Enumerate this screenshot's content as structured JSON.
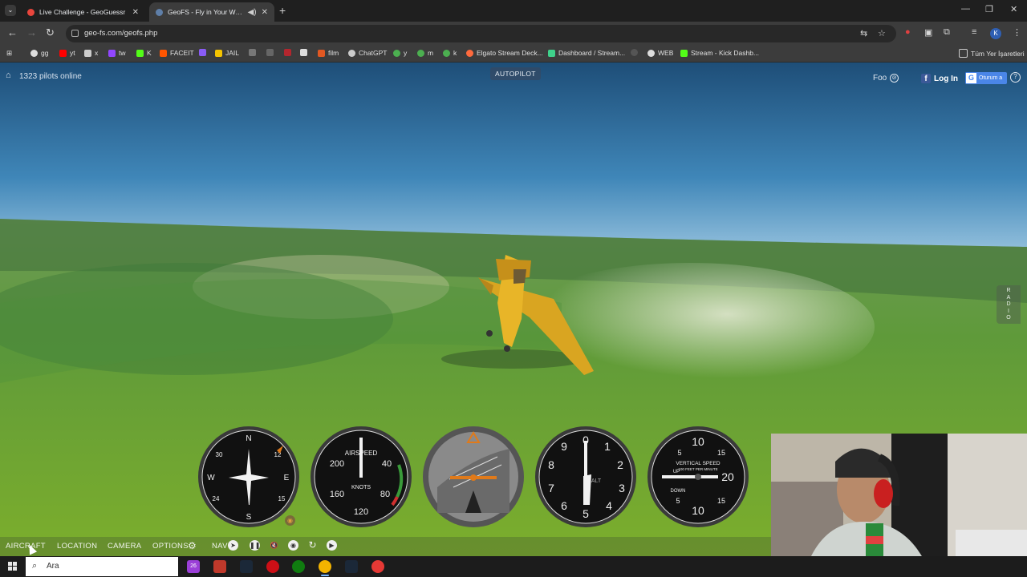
{
  "browser": {
    "tabs": [
      {
        "title": "Live Challenge - GeoGuessr",
        "favicon_color": "#e8453c",
        "active": false
      },
      {
        "title": "GeoFS - Fly in Your Web Br...",
        "favicon_color": "#5f7fa8",
        "active": true
      }
    ],
    "url": "geo-fs.com/geofs.php",
    "profile_initial": "K",
    "bookmarks": [
      {
        "label": "gg",
        "color": "#dddddd"
      },
      {
        "label": "yt",
        "color": "#ff0000"
      },
      {
        "label": "x",
        "color": "#cccccc"
      },
      {
        "label": "tw",
        "color": "#9146ff"
      },
      {
        "label": "K",
        "color": "#53fc18"
      },
      {
        "label": "FACEIT",
        "color": "#ff5500"
      },
      {
        "label": "",
        "color": "#8a5cf5"
      },
      {
        "label": "JAIL",
        "color": "#f5c400"
      },
      {
        "label": "",
        "color": "#777777"
      },
      {
        "label": "",
        "color": "#666666"
      },
      {
        "label": "",
        "color": "#b3262e"
      },
      {
        "label": "",
        "color": "#dddddd"
      },
      {
        "label": "film",
        "color": "#e25822"
      },
      {
        "label": "ChatGPT",
        "color": "#cccccc"
      },
      {
        "label": "y",
        "color": "#4caf50"
      },
      {
        "label": "m",
        "color": "#4caf50"
      },
      {
        "label": "k",
        "color": "#4caf50"
      },
      {
        "label": "Elgato Stream Deck...",
        "color": "#ff6a3d"
      },
      {
        "label": "Dashboard / Stream...",
        "color": "#3fd18b"
      },
      {
        "label": "",
        "color": "#555555"
      },
      {
        "label": "WEB",
        "color": "#dddddd"
      },
      {
        "label": "Stream - Kick Dashb...",
        "color": "#53fc18"
      }
    ],
    "all_bookmarks_label": "Tüm Yer İşaretleri"
  },
  "game": {
    "pilots_online": "1323 pilots online",
    "autopilot_label": "AUTOPILOT",
    "foo_label": "Foo",
    "login_label": "Log In",
    "google_signin_label": "Oturum a",
    "radio_label": [
      "R",
      "A",
      "D",
      "I",
      "O"
    ],
    "instruments": {
      "heading": {
        "labels": [
          "N",
          "3",
          "6",
          "E",
          "12",
          "15",
          "S",
          "21",
          "24",
          "W",
          "30",
          "33"
        ]
      },
      "airspeed": {
        "title": "AIRSPEED",
        "unit": "KNOTS",
        "labels": [
          "200",
          "40",
          "160",
          "80",
          "120"
        ]
      },
      "altimeter": {
        "labels": [
          "0",
          "1",
          "2",
          "3",
          "4",
          "5",
          "6",
          "7",
          "8",
          "9"
        ],
        "center": "ALT"
      },
      "vsi": {
        "title": "VERTICAL SPEED",
        "subtitle": "100 FEET PER MINUTE",
        "up": "UP",
        "down": "DOWN",
        "labels": [
          "10",
          "5",
          "20",
          "15",
          "10",
          "15",
          "5"
        ]
      }
    },
    "controls": {
      "aircraft": "AIRCRAFT",
      "location": "LOCATION",
      "camera": "CAMERA",
      "options": "OPTIONS",
      "nav": "NAV"
    }
  },
  "taskbar": {
    "search_placeholder": "Ara",
    "apps": [
      {
        "name": "app-purple",
        "color": "#9b3fd8",
        "label": "26"
      },
      {
        "name": "app-news",
        "color": "#c0392b",
        "label": ""
      },
      {
        "name": "app-steam-1",
        "color": "#1b2838",
        "label": ""
      },
      {
        "name": "app-opera",
        "color": "#cc0f16",
        "label": ""
      },
      {
        "name": "app-xbox",
        "color": "#107c10",
        "label": ""
      },
      {
        "name": "app-chrome",
        "color": "#f4b400",
        "label": "",
        "active": true
      },
      {
        "name": "app-steam-2",
        "color": "#1b2838",
        "label": ""
      },
      {
        "name": "app-game",
        "color": "#e53935",
        "label": ""
      }
    ]
  }
}
